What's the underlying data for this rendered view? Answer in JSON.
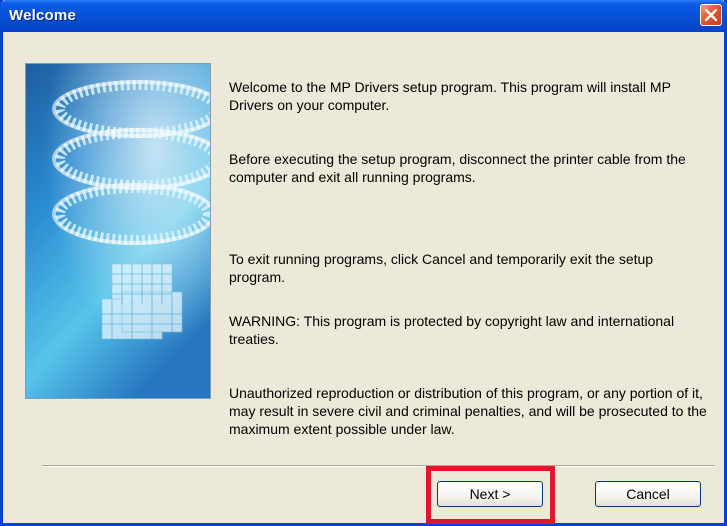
{
  "window": {
    "title": "Welcome"
  },
  "content": {
    "paragraphs": [
      "Welcome to the MP Drivers setup program. This program will install MP Drivers on your computer.",
      "Before executing the setup program, disconnect the printer cable from the computer and exit all running programs.",
      "To exit running programs, click Cancel and temporarily exit the setup program.",
      "WARNING: This program is protected by copyright law and international treaties.",
      "Unauthorized reproduction or distribution of this program, or any portion of it, may result in severe civil and criminal penalties, and will be prosecuted to the maximum extent possible under law."
    ]
  },
  "buttons": {
    "next": "Next >",
    "cancel": "Cancel"
  },
  "icons": {
    "close": "close-icon",
    "art": "setup-banner-image"
  },
  "colors": {
    "titlebar": "#0852d8",
    "close": "#e5562f",
    "highlight": "#e0162b",
    "dialog_bg": "#ece9d8"
  }
}
